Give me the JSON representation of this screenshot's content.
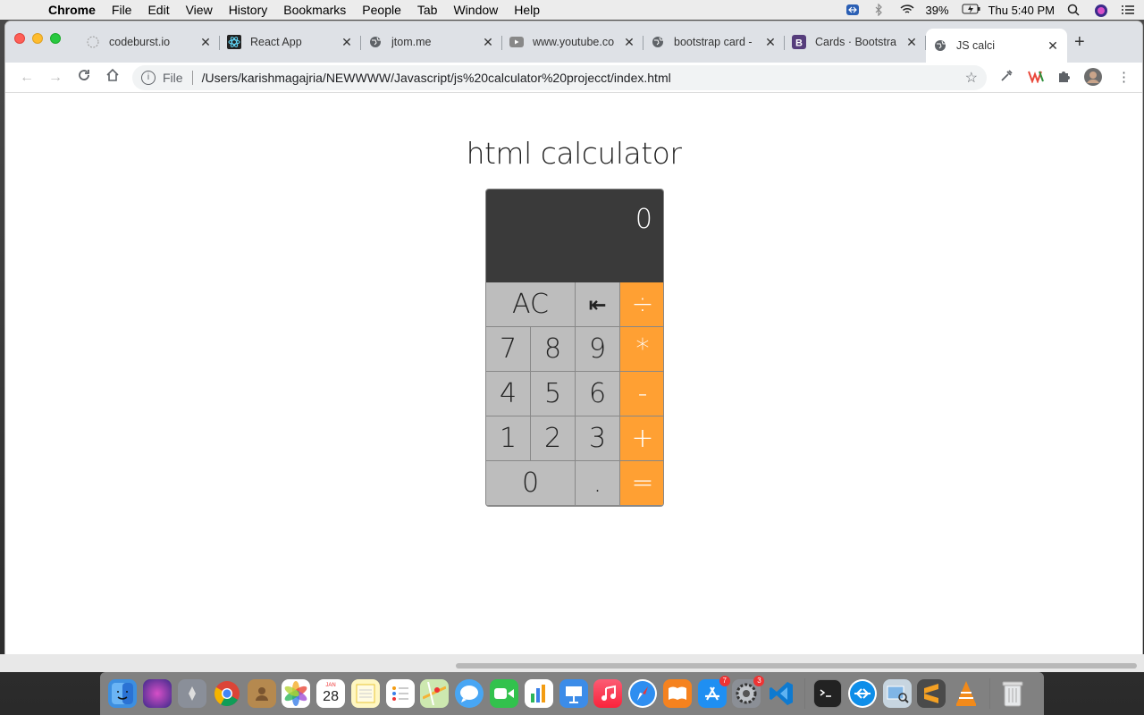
{
  "menubar": {
    "app": "Chrome",
    "items": [
      "File",
      "Edit",
      "View",
      "History",
      "Bookmarks",
      "People",
      "Tab",
      "Window",
      "Help"
    ],
    "battery": "39%",
    "clock": "Thu 5:40 PM"
  },
  "tabs": [
    {
      "title": "codeburst.io",
      "icon": "codeburst-icon"
    },
    {
      "title": "React App",
      "icon": "react-icon"
    },
    {
      "title": "jtom.me",
      "icon": "globe-icon"
    },
    {
      "title": "www.youtube.co",
      "icon": "youtube-icon"
    },
    {
      "title": "bootstrap card -",
      "icon": "globe-icon"
    },
    {
      "title": "Cards · Bootstra",
      "icon": "bootstrap-icon"
    },
    {
      "title": "JS calci",
      "icon": "globe-icon",
      "active": true
    }
  ],
  "omnibox": {
    "scheme": "File",
    "url": "/Users/karishmagajria/NEWWWW/Javascript/js%20calculator%20projecct/index.html"
  },
  "page": {
    "title": "html calculator",
    "display": "0",
    "keys": {
      "ac": "AC",
      "back": "⇤",
      "divide": "÷",
      "seven": "7",
      "eight": "8",
      "nine": "9",
      "multiply": "*",
      "four": "4",
      "five": "5",
      "six": "6",
      "minus": "-",
      "one": "1",
      "two": "2",
      "three": "3",
      "plus": "+",
      "zero": "0",
      "dot": ".",
      "equals": "="
    },
    "colors": {
      "operator": "#ffa033",
      "screen": "#3a3a3a",
      "key": "#bdbdbd"
    }
  },
  "dock": {
    "badges": {
      "appstore": "7",
      "settings": "3"
    },
    "calendar_month": "JAN",
    "calendar_day": "28"
  }
}
